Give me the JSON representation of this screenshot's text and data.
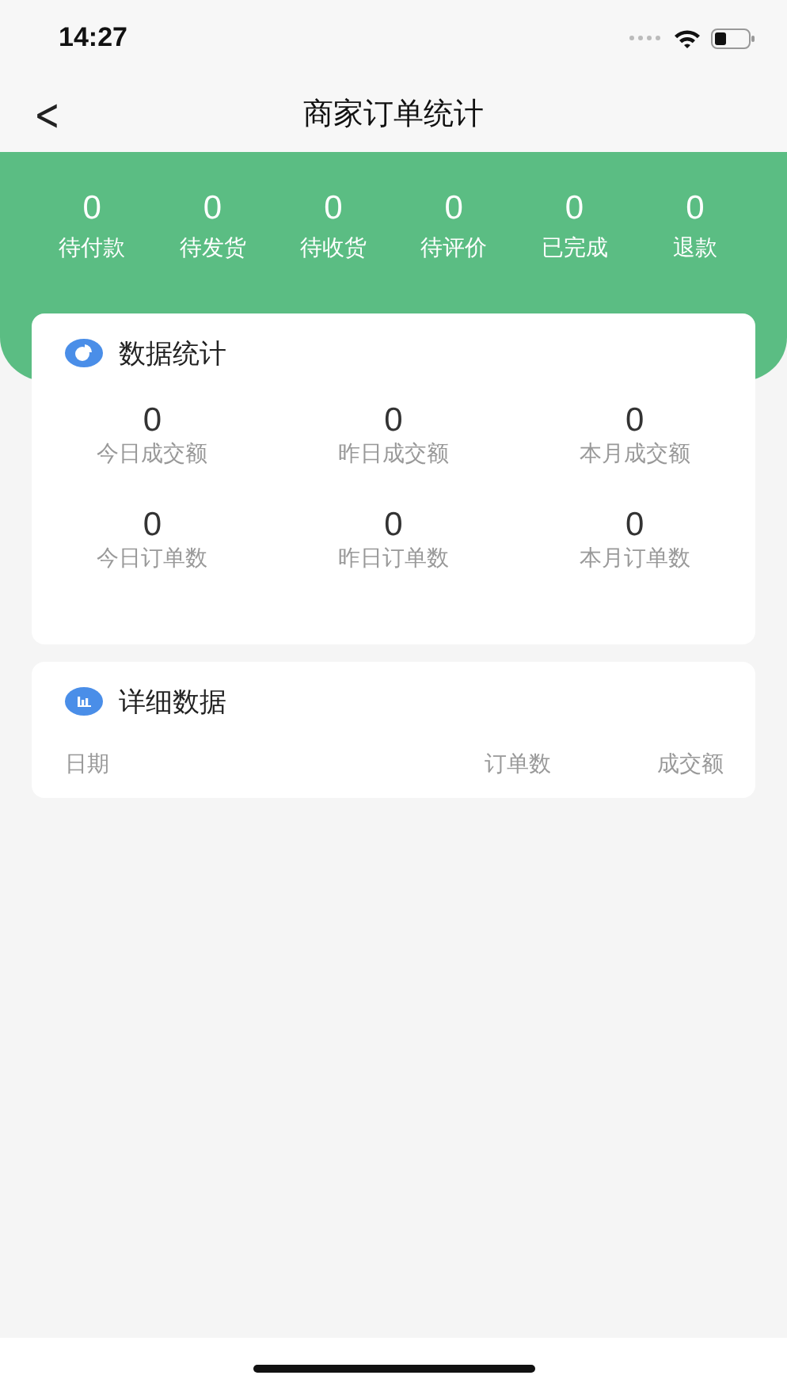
{
  "status_bar": {
    "time": "14:27"
  },
  "nav": {
    "back": "<",
    "title": "商家订单统计"
  },
  "order_states": [
    {
      "count": "0",
      "label": "待付款"
    },
    {
      "count": "0",
      "label": "待发货"
    },
    {
      "count": "0",
      "label": "待收货"
    },
    {
      "count": "0",
      "label": "待评价"
    },
    {
      "count": "0",
      "label": "已完成"
    },
    {
      "count": "0",
      "label": "退款"
    }
  ],
  "stats_card": {
    "title": "数据统计",
    "items": [
      {
        "value": "0",
        "label": "今日成交额"
      },
      {
        "value": "0",
        "label": "昨日成交额"
      },
      {
        "value": "0",
        "label": "本月成交额"
      },
      {
        "value": "0",
        "label": "今日订单数"
      },
      {
        "value": "0",
        "label": "昨日订单数"
      },
      {
        "value": "0",
        "label": "本月订单数"
      }
    ]
  },
  "detail_card": {
    "title": "详细数据",
    "columns": [
      "日期",
      "订单数",
      "成交额"
    ]
  }
}
